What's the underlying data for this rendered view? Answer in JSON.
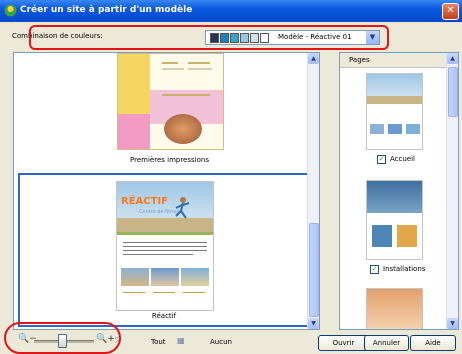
{
  "window": {
    "title": "Créer un site à partir d'un modèle",
    "close_glyph": "✕"
  },
  "scheme": {
    "label": "Combinaison de couleurs:",
    "value": "Modèle - Réactive 01",
    "swatches": [
      "#24364f",
      "#1f7fc5",
      "#3aa1c9",
      "#98c7e6",
      "#cfe0ee",
      "#ffffff"
    ],
    "dropdown_glyph": "▼"
  },
  "templates": {
    "items": [
      {
        "label": "Premières impressions",
        "selected": false
      },
      {
        "label": "Réactif",
        "selected": true
      }
    ],
    "thumb2_logo": "RÉACTIF",
    "thumb2_subtitle": "Centre de fitness"
  },
  "pages": {
    "header": "Pages",
    "items": [
      {
        "label": "Accueil",
        "checked": true
      },
      {
        "label": "Installations",
        "checked": true
      }
    ],
    "check_glyph": "✓"
  },
  "zoom": {
    "zoom_out_glyph": "🔍−",
    "zoom_in_glyph": "🔍+",
    "level": 0.45,
    "fit_glyph": "⤧"
  },
  "selection": {
    "all_label": "Tout",
    "none_label": "Aucun",
    "grid_glyph": "▦"
  },
  "buttons": {
    "open": "Ouvrir",
    "cancel": "Annuler",
    "help": "Aide"
  },
  "scroll": {
    "up_glyph": "▲",
    "down_glyph": "▼"
  },
  "colors": {
    "titlebar": "#0a59e1",
    "accent": "#3166c8",
    "highlight": "#e01515"
  }
}
